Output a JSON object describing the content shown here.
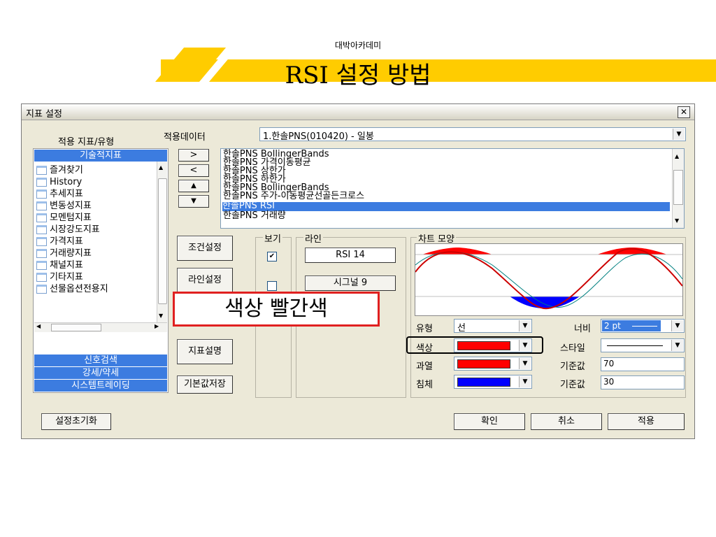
{
  "slide": {
    "subtitle": "대박아카데미",
    "title": "RSI 설정 방법"
  },
  "colors": {
    "accent": "#FFCC00",
    "selection": "#3C7CE0",
    "red": "#FF0000",
    "blue": "#0000FF"
  },
  "dialog": {
    "title": "지표 설정",
    "close_label": "✕",
    "apply_target_label": "적용 지표/유형",
    "apply_data_label": "적용데이터",
    "apply_data_value": "1.한솔PNS(010420) - 일봉",
    "categories": {
      "technical": "기술적지표",
      "signal_search": "신호검색",
      "strong_weak": "강세/약세",
      "system_trading": "시스템트레이딩"
    },
    "tree_items": [
      "즐겨찾기",
      "History",
      "추세지표",
      "변동성지표",
      "모멘텀지표",
      "시장강도지표",
      "가격지표",
      "거래량지표",
      "채널지표",
      "기타지표",
      "선물옵션전용지"
    ],
    "move_buttons": {
      "add": ">",
      "remove": "<",
      "up": "▲",
      "down": "▼"
    },
    "indicators": [
      "한솔PNS BollingerBands",
      "한솔PNS 가격이동평균",
      "한솔PNS 상한가",
      "한솔PNS 하한가",
      "한솔PNS BollingerBands",
      "한솔PNS 주가-이동평균선골든크로스",
      "한솔PNS RSI",
      "한솔PNS 거래량"
    ],
    "side_buttons": {
      "condition": "조건설정",
      "line": "라인설정",
      "description": "지표설명",
      "save_default": "기본값저장"
    },
    "groups": {
      "view": "보기",
      "line": "라인",
      "chart_shape": "차트 모양"
    },
    "line_items": [
      "RSI 14",
      "시그널 9"
    ],
    "props": {
      "type_label": "유형",
      "type_value": "선",
      "width_label": "너비",
      "width_value": "2 pt",
      "color_label": "색상",
      "style_label": "스타일",
      "overbought_label": "과열",
      "overbought_base_label": "기준값",
      "overbought_base_value": "70",
      "oversold_label": "침체",
      "oversold_base_label": "기준값",
      "oversold_base_value": "30"
    },
    "bottom_buttons": {
      "reset": "설정초기화",
      "ok": "확인",
      "cancel": "취소",
      "apply": "적용"
    }
  },
  "annotation": {
    "text": "색상 빨간색"
  }
}
